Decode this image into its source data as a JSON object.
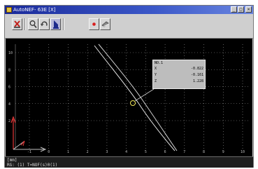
{
  "window": {
    "title": "AutoNEF- 63E [X]",
    "controls": {
      "minimize": "_",
      "maximize": "□",
      "close": "×"
    }
  },
  "toolbar": {
    "buttons": [
      {
        "name": "clear-button",
        "icon": "cross-icon"
      },
      {
        "name": "zoom-button",
        "icon": "magnifier-icon"
      },
      {
        "name": "rotate-button",
        "icon": "rotate-icon"
      },
      {
        "name": "pointer-button",
        "icon": "pointer-icon"
      },
      {
        "name": "record-button",
        "icon": "record-dot-icon"
      },
      {
        "name": "print-button",
        "icon": "printer-icon"
      }
    ]
  },
  "plot": {
    "y_ticks": [
      "10",
      "8",
      "6",
      "4",
      "2"
    ],
    "x_ticks": [
      "-1",
      "0",
      "1",
      "2",
      "3",
      "4",
      "5",
      "6",
      "7",
      "8",
      "9",
      "10"
    ],
    "colors": {
      "curve": "#e6e6e6",
      "grid": "#9a9a9a",
      "axis_red": "#e53a3a",
      "marker": "#f2e85a"
    },
    "info_box": {
      "heading": "NO.1",
      "rows": [
        {
          "key": "X",
          "value": "-0.822"
        },
        {
          "key": "Y",
          "value": "-0.161"
        },
        {
          "key": "Z",
          "value": "1.228"
        }
      ]
    }
  },
  "status": {
    "line1": "[mm]",
    "line2": "RG: (1) T=NOF(s)0(1)"
  }
}
